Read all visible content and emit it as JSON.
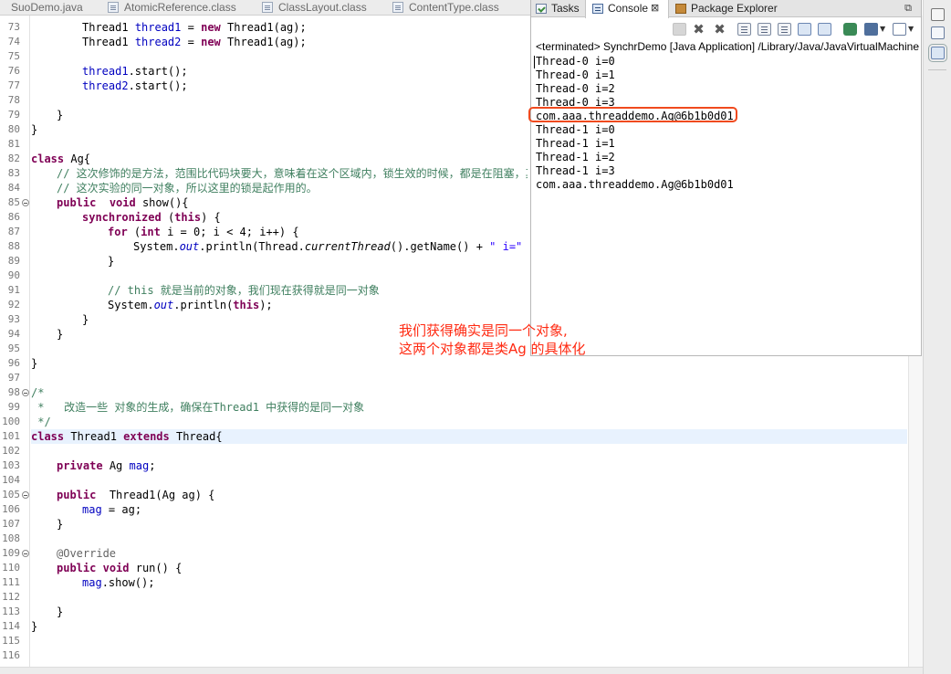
{
  "editor": {
    "tabs": [
      {
        "label": "SuoDemo.java",
        "icon": "java-file-icon"
      },
      {
        "label": "AtomicReference.class",
        "icon": "class-file-icon"
      },
      {
        "label": "ClassLayout.class",
        "icon": "class-file-icon"
      },
      {
        "label": "ContentType.class",
        "icon": "class-file-icon"
      }
    ],
    "line_numbers": [
      "73",
      "74",
      "75",
      "76",
      "77",
      "78",
      "79",
      "80",
      "81",
      "82",
      "83",
      "84",
      "85",
      "86",
      "87",
      "88",
      "89",
      "90",
      "91",
      "92",
      "93",
      "94",
      "95",
      "96",
      "97",
      "98",
      "99",
      "100",
      "101",
      "102",
      "103",
      "104",
      "105",
      "106",
      "107",
      "108",
      "109",
      "110",
      "111",
      "112",
      "113",
      "114",
      "115",
      "116"
    ],
    "folds": [
      "85",
      "98",
      "105",
      "109"
    ],
    "current_line": "101",
    "code": {
      "l73": {
        "t1": "Thread1",
        "v": "thread1",
        "eq": "=",
        "kw": "new",
        "t2": "Thread1(ag);"
      },
      "l74": {
        "t1": "Thread1",
        "v": "thread2",
        "eq": "=",
        "kw": "new",
        "t2": "Thread1(ag);"
      },
      "l76": {
        "v": "thread1",
        "rest": ".start();"
      },
      "l77": {
        "v": "thread2",
        "rest": ".start();"
      },
      "l79": "}",
      "l80": "}",
      "l82": {
        "kw": "class",
        "rest": "Ag{"
      },
      "l83": "// 这次修饰的是方法，范围比代码块要大，意味着在这个区域内，锁生效的时候，都是在阻塞，其他线程",
      "l84": "// 这次实验的同一对象，所以这里的锁是起作用的。",
      "l85": {
        "kw1": "public",
        "kw2": "void",
        "rest": "show(){"
      },
      "l86": {
        "kw1": "synchronized",
        "mid": "(",
        "kw2": "this",
        "rest": ") {"
      },
      "l87": {
        "kw1": "for",
        "a": "(",
        "kw2": "int",
        "b": "i = 0; i < 4; i++) {"
      },
      "l88": {
        "a": "System.",
        "out": "out",
        "b": ".println(Thread.",
        "ct": "currentThread",
        "c": "().getName() + ",
        "s": "\" i=\"",
        "d": " +"
      },
      "l89": "}",
      "l91": "// this 就是当前的对象，我们现在获得就是同一对象",
      "l92": {
        "a": "System.",
        "out": "out",
        "b": ".println(",
        "kw": "this",
        "c": ");"
      },
      "l93": "}",
      "l94": "}",
      "l96": "}",
      "l98": "/*",
      "l99": " *   改造一些 对象的生成，确保在Thread1 中获得的是同一对象",
      "l100": " */",
      "l101": {
        "kw1": "class",
        "name": "Thread1",
        "kw2": "extends",
        "rest": "Thread{"
      },
      "l103": {
        "kw": "private",
        "type": "Ag",
        "f": "mag",
        "rest": ";"
      },
      "l105": {
        "kw": "public",
        "rest": "Thread1(Ag ag) {"
      },
      "l106": {
        "f": "mag",
        "rest": "= ag;"
      },
      "l107": "}",
      "l109": "@Override",
      "l110": {
        "kw1": "public",
        "kw2": "void",
        "rest": "run() {"
      },
      "l111": {
        "f": "mag",
        "rest": ".show();"
      },
      "l113": "}",
      "l114": "}"
    }
  },
  "console_view": {
    "tabs": [
      {
        "label": "Tasks",
        "icon": "tasks-icon"
      },
      {
        "label": "Console",
        "icon": "console-icon",
        "active": true
      },
      {
        "label": "Package Explorer",
        "icon": "package-explorer-icon"
      }
    ],
    "close_glyph": "⊠",
    "restore_glyph": "⧉",
    "header": "<terminated> SynchrDemo [Java Application] /Library/Java/JavaVirtualMachines",
    "output": [
      "Thread-0 i=0",
      "Thread-0 i=1",
      "Thread-0 i=2",
      "Thread-0 i=3",
      "com.aaa.threaddemo.Ag@6b1b0d01",
      "Thread-1 i=0",
      "Thread-1 i=1",
      "Thread-1 i=2",
      "Thread-1 i=3",
      "com.aaa.threaddemo.Ag@6b1b0d01"
    ],
    "highlight_color": "#f04a1e"
  },
  "annotation": {
    "line1": "我们获得确实是同一个对象,",
    "line2": "这两个对象都是类Ag  的具体化",
    "color": "#ff2a12"
  }
}
